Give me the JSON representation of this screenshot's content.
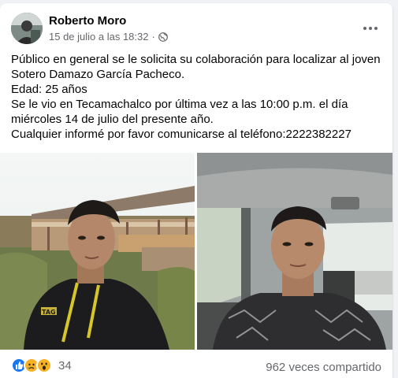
{
  "post": {
    "author": "Roberto Moro",
    "date": "15 de julio a las 18:32",
    "separator": "·",
    "privacy_icon": "globe-icon",
    "more_icon": "more-options-icon",
    "lines": [
      "Público en general se le solicita su colaboración para localizar al joven",
      "Sotero Damazo García Pacheco.",
      "Edad: 25 años",
      "Se le vio en Tecamachalco por última vez a las 10:00 p.m. el día",
      "miércoles 14 de julio del presente año.",
      "Cualquier informé por favor comunicarse al teléfono:2222382227"
    ]
  },
  "photos": {
    "left_logo": "TAG"
  },
  "footer": {
    "reaction_icons": [
      "like-icon",
      "sad-icon",
      "wow-icon"
    ],
    "reaction_count": "34",
    "shares": "962 veces compartido"
  },
  "colors": {
    "text_primary": "#050505",
    "text_secondary": "#65676b",
    "like_blue": "#1877f2",
    "reaction_yellow": "#f7b125"
  }
}
